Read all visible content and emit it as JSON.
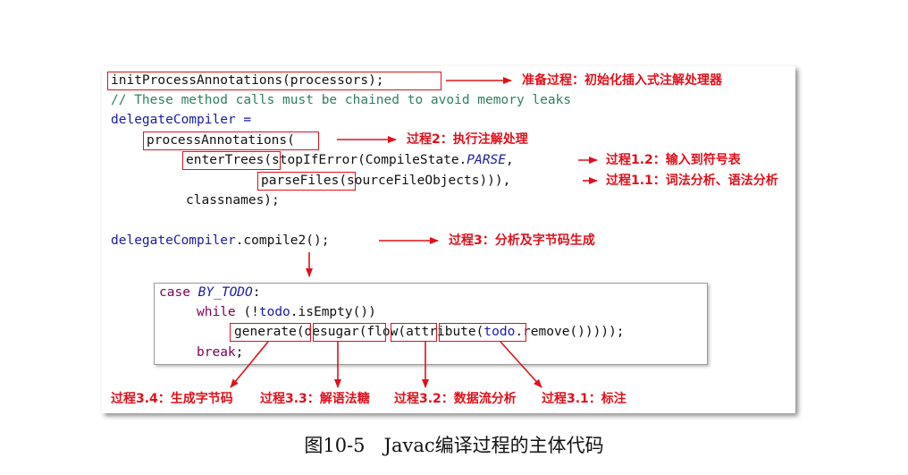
{
  "code": {
    "line1": "initProcessAnnotations(processors);",
    "line2": "// These method calls must be chained to avoid memory leaks",
    "line3": "delegateCompiler =",
    "line4_fn": "processAnnotations",
    "line4_rest": "(",
    "line5_fn": "enterTrees",
    "line5_rest_a": "(stopIfError(CompileState.",
    "line5_rest_b": "PARSE",
    "line5_rest_c": ",",
    "line6_fn": "parseFiles",
    "line6_rest": "(sourceFileObjects))),",
    "line7": "classnames);",
    "line8_a": "delegateCompiler",
    "line8_b": ".compile2();",
    "inner_line1_kw": "case",
    "inner_line1_id": "BY_TODO",
    "inner_line1_rest": ":",
    "inner_line2_kw": "while",
    "inner_line2_rest": " (!",
    "inner_line2_id": "todo",
    "inner_line2_end": ".isEmpty())",
    "inner_line3_a": "generate",
    "inner_line3_b": "desugar",
    "inner_line3_c": "flow",
    "inner_line3_d": "attribute",
    "inner_line3_e": "(",
    "inner_line3_f": "todo",
    "inner_line3_g": ".remove()))));",
    "inner_line4_kw": "break",
    "inner_line4_rest": ";"
  },
  "annotations": {
    "prepare": "准备过程：初始化插入式注解处理器",
    "process2": "过程2：执行注解处理",
    "process12": "过程1.2：输入到符号表",
    "process11": "过程1.1：词法分析、语法分析",
    "process3": "过程3：分析及字节码生成",
    "process34": "过程3.4：生成字节码",
    "process33": "过程3.3：解语法糖",
    "process32": "过程3.2：数据流分析",
    "process31": "过程3.1：标注"
  },
  "caption": "图10-5　Javac编译过程的主体代码",
  "colors": {
    "accent": "#e0101a",
    "comment": "#2f7f5f",
    "identifier": "#1a1aa6",
    "keyword": "#7f0055"
  }
}
